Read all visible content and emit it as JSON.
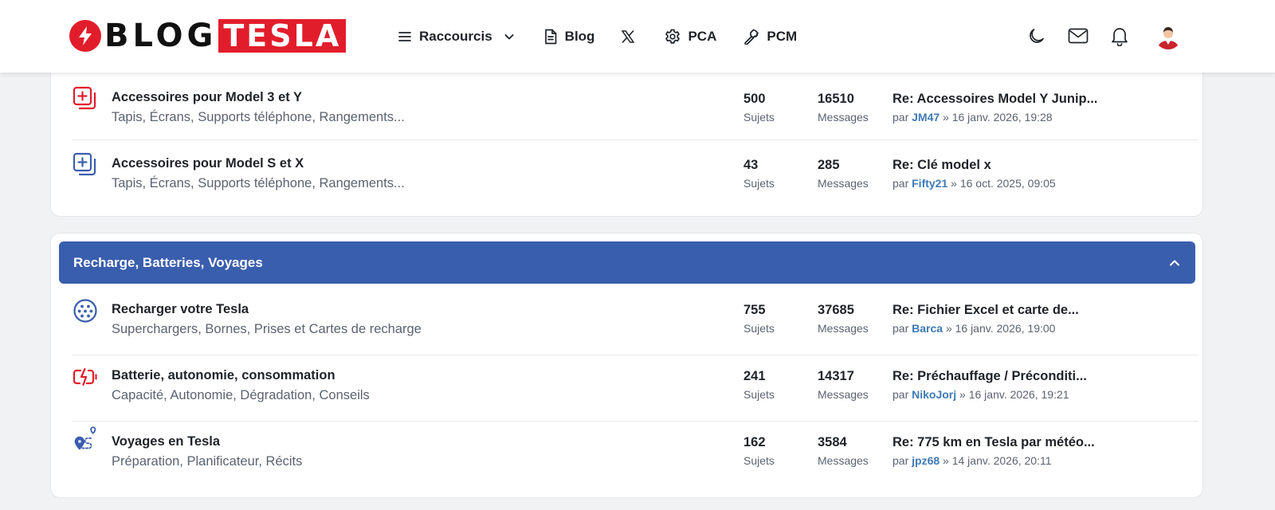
{
  "header": {
    "logo_part1": "BLOG",
    "logo_part2": "TESLA",
    "nav": {
      "raccourcis": "Raccourcis",
      "blog": "Blog",
      "pca": "PCA",
      "pcm": "PCM"
    }
  },
  "colors": {
    "brand_red": "#e21d2b",
    "category_blue": "#3a5eae",
    "link_blue": "#3e7ab8"
  },
  "labels": {
    "subjects": "Sujets",
    "messages": "Messages",
    "by": "par"
  },
  "sections": [
    {
      "title": "",
      "forums": [
        {
          "icon": "plus-copy-icon",
          "icon_color": "#e21d2b",
          "title": "Accessoires pour Model 3 et Y",
          "description": "Tapis, Écrans, Supports téléphone, Rangements...",
          "topics": "500",
          "posts": "16510",
          "last_post_title": "Re: Accessoires Model Y Junip...",
          "last_post_user": "JM47",
          "last_post_date": "» 16 janv. 2026, 19:28"
        },
        {
          "icon": "plus-copy-icon",
          "icon_color": "#3a5eae",
          "title": "Accessoires pour Model S et X",
          "description": "Tapis, Écrans, Supports téléphone, Rangements...",
          "topics": "43",
          "posts": "285",
          "last_post_title": "Re: Clé model x",
          "last_post_user": "Fifty21",
          "last_post_date": "» 16 oct. 2025, 09:05"
        }
      ]
    },
    {
      "title": "Recharge, Batteries, Voyages",
      "forums": [
        {
          "icon": "ev-plug-icon",
          "icon_color": "#3a5eae",
          "title": "Recharger votre Tesla",
          "description": "Superchargers, Bornes, Prises et Cartes de recharge",
          "topics": "755",
          "posts": "37685",
          "last_post_title": "Re: Fichier Excel et carte de...",
          "last_post_user": "Barca",
          "last_post_date": "» 16 janv. 2026, 19:00"
        },
        {
          "icon": "battery-charging-icon",
          "icon_color": "#e21d2b",
          "title": "Batterie, autonomie, consommation",
          "description": "Capacité, Autonomie, Dégradation, Conseils",
          "topics": "241",
          "posts": "14317",
          "last_post_title": "Re: Préchauffage / Préconditi...",
          "last_post_user": "NikoJorj",
          "last_post_date": "» 16 janv. 2026, 19:21"
        },
        {
          "icon": "route-icon",
          "icon_color": "#3a5eae",
          "title": "Voyages en Tesla",
          "description": "Préparation, Planificateur, Récits",
          "topics": "162",
          "posts": "3584",
          "last_post_title": "Re: 775 km en Tesla par météo...",
          "last_post_user": "jpz68",
          "last_post_date": "» 14 janv. 2026, 20:11"
        }
      ]
    }
  ]
}
